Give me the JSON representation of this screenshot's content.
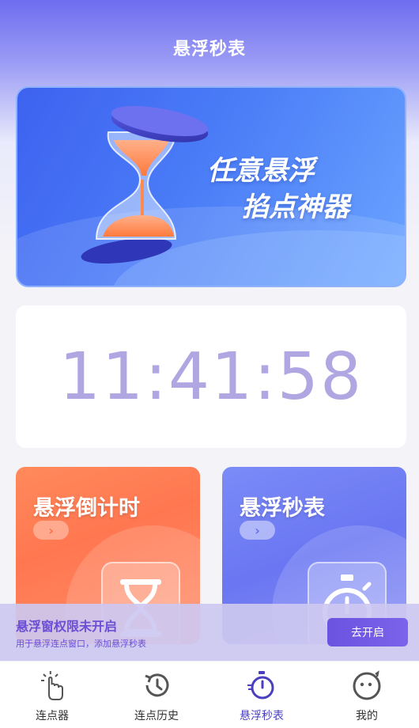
{
  "header": {
    "title": "悬浮秒表"
  },
  "banner": {
    "line1": "任意悬浮",
    "line2": "掐点神器"
  },
  "clock": {
    "time": "11:41:58"
  },
  "cards": [
    {
      "title": "悬浮倒计时",
      "arrow": "›",
      "icon": "hourglass-icon",
      "color": "#ff7a52"
    },
    {
      "title": "悬浮秒表",
      "arrow": "›",
      "icon": "stopwatch-icon",
      "color": "#6a76f2"
    }
  ],
  "permission": {
    "title": "悬浮窗权限未开启",
    "subtitle": "用于悬浮连点窗口，添加悬浮秒表",
    "button": "去开启"
  },
  "tabs": [
    {
      "label": "连点器",
      "icon": "tap-hand-icon"
    },
    {
      "label": "连点历史",
      "icon": "history-clock-icon"
    },
    {
      "label": "悬浮秒表",
      "icon": "stopwatch-icon",
      "active": true
    },
    {
      "label": "我的",
      "icon": "smiley-face-icon"
    }
  ],
  "colors": {
    "accent": "#4a3fc0",
    "orange": "#ff7a52",
    "blue": "#6a76f2",
    "clock_text": "#b0a7e2"
  }
}
